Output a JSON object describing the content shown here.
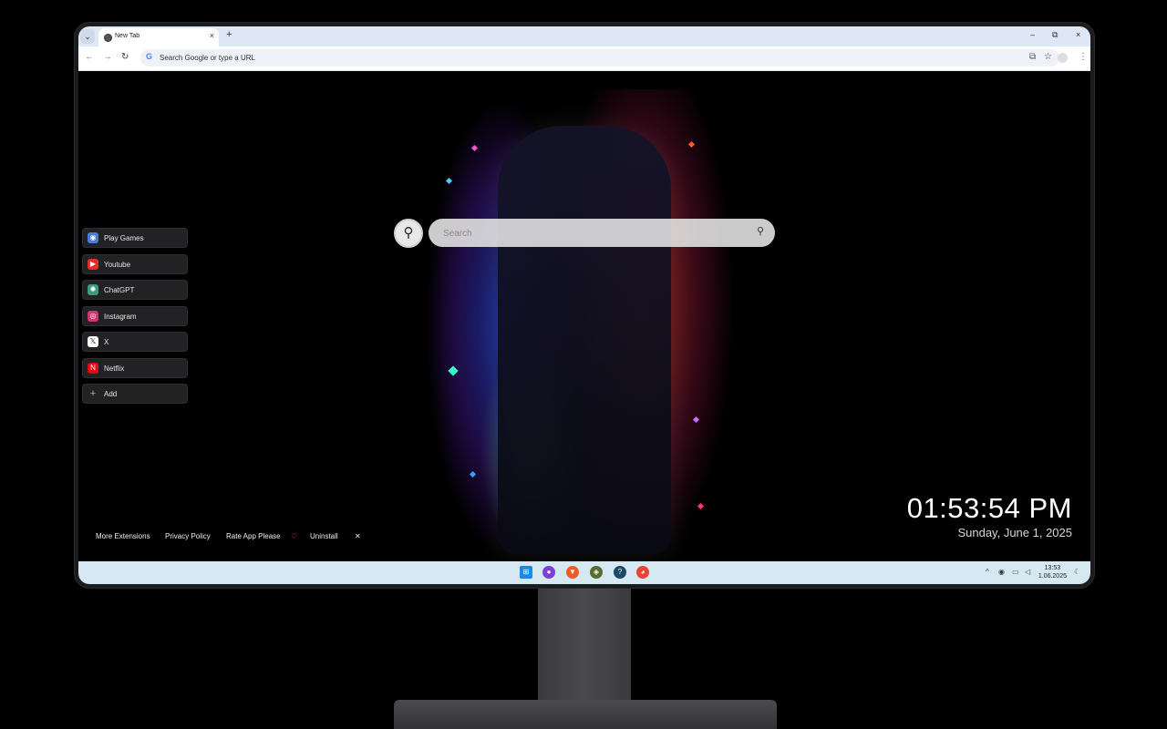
{
  "browser": {
    "tab_title": "New Tab",
    "tab_close": "×",
    "new_tab": "+",
    "menu_chevron": "⌄",
    "window_controls": {
      "minimize": "–",
      "restore": "⧉",
      "close": "×"
    },
    "nav": {
      "back": "←",
      "forward": "→",
      "reload": "↻"
    },
    "omnibox_placeholder": "Search Google or type a URL",
    "omnibox_google_glyph": "G",
    "bookmark_star": "☆",
    "extensions_glyph": "⧉",
    "menu_dots": "⋮"
  },
  "shortcuts": [
    {
      "label": "Play Games",
      "icon": "gamepad-icon",
      "color": "#4a7bd8",
      "glyph": "◉"
    },
    {
      "label": "Youtube",
      "icon": "youtube-icon",
      "color": "#e52d27",
      "glyph": "▶"
    },
    {
      "label": "ChatGPT",
      "icon": "chatgpt-icon",
      "color": "#3c9b7f",
      "glyph": "✺"
    },
    {
      "label": "Instagram",
      "icon": "instagram-icon",
      "color": "#d6336c",
      "glyph": "◎"
    },
    {
      "label": "X",
      "icon": "x-icon",
      "color": "#ffffff",
      "glyph": "𝕏"
    },
    {
      "label": "Netflix",
      "icon": "netflix-icon",
      "color": "#e50914",
      "glyph": "N"
    },
    {
      "label": "Add",
      "icon": "plus-icon",
      "color": "transparent",
      "glyph": "+"
    }
  ],
  "search": {
    "placeholder": "Search",
    "button_glyph": "⚲",
    "inner_glyph": "⚲"
  },
  "footer": {
    "more_extensions": "More Extensions",
    "privacy_policy": "Privacy Policy",
    "rate_app": "Rate App Please",
    "heart": "♡",
    "uninstall": "Uninstall",
    "close": "✕"
  },
  "clock": {
    "time": "01:53:54 PM",
    "date": "Sunday, June 1, 2025"
  },
  "taskbar": {
    "apps": [
      {
        "name": "windows-start-icon",
        "color": "#1e88e5",
        "glyph": "⊞"
      },
      {
        "name": "app-purple-icon",
        "color": "#7b3fd8",
        "glyph": "●"
      },
      {
        "name": "brave-icon",
        "color": "#f05a28",
        "glyph": "▼"
      },
      {
        "name": "game-app-icon",
        "color": "#5a6b2f",
        "glyph": "◈"
      },
      {
        "name": "help-app-icon",
        "color": "#1a4a6a",
        "glyph": "?"
      },
      {
        "name": "chrome-icon",
        "color": "#e84335",
        "glyph": "◕"
      }
    ],
    "tray": {
      "chevron": "^",
      "time": "13:53",
      "date": "1.06.2025"
    }
  }
}
